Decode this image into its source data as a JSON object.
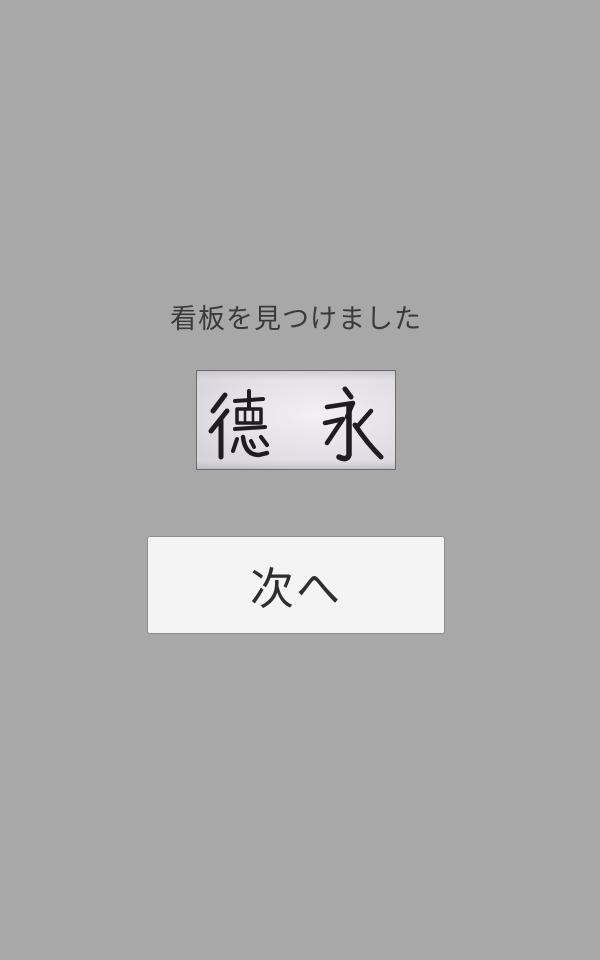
{
  "screen": {
    "message": "看板を見つけました",
    "sign_image": {
      "text": "徳永",
      "kind": "photo of hand-lettered signboard"
    },
    "next_button": {
      "label": "次へ"
    }
  },
  "colors": {
    "background": "#a8a8a8",
    "button_background": "#f4f4f4",
    "text": "#3a3a3a"
  }
}
